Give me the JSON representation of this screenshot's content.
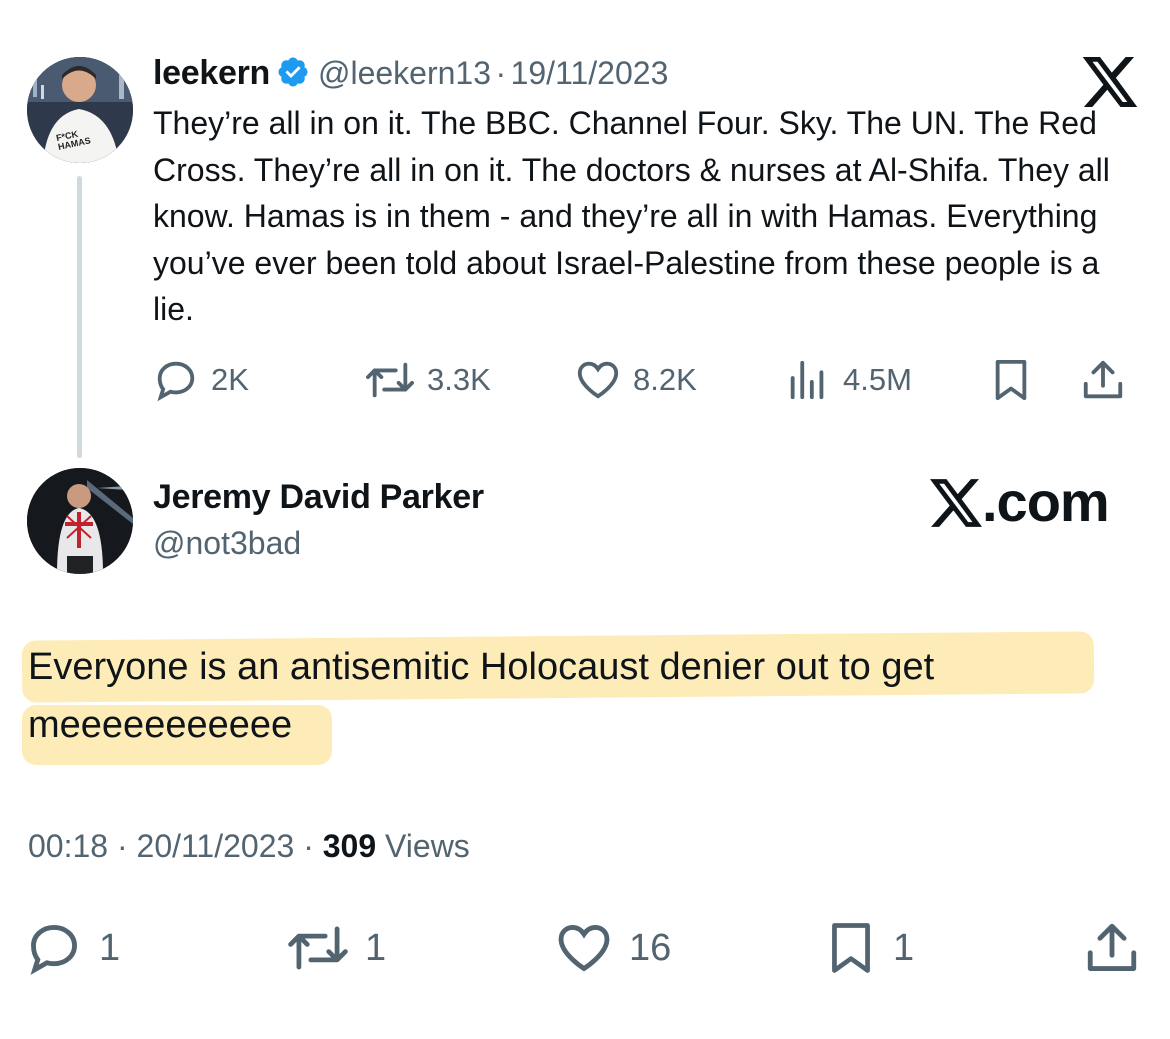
{
  "tweet1": {
    "display_name": "leekern",
    "handle": "@leekern13",
    "separator": "·",
    "date": "19/11/2023",
    "text": "They’re all in on it. The BBC. Channel Four. Sky. The UN. The Red Cross. They’re all in on it. The doctors & nurses at Al-Shifa. They all know. Hamas is in them - and they’re all in with Hamas. Everything you’ve ever been told about Israel-Palestine from these people is a lie.",
    "avatar_shirt_text": "F*CK HAMAS",
    "stats": {
      "replies": "2K",
      "reposts": "3.3K",
      "likes": "8.2K",
      "views": "4.5M"
    }
  },
  "tweet2": {
    "display_name": "Jeremy David Parker",
    "handle": "@not3bad",
    "text": "Everyone is an antisemitic Holocaust denier out to get meeeeeeeeeee",
    "time": "00:18",
    "separator": "·",
    "date": "20/11/2023",
    "views_count": "309",
    "views_label": "Views",
    "stats": {
      "replies": "1",
      "reposts": "1",
      "likes": "16",
      "bookmarks": "1"
    }
  },
  "brand": {
    "watermark_text": ".com",
    "logo_icon": "x-logo-icon"
  },
  "colors": {
    "text": "#0f1419",
    "secondary": "#536471",
    "verified": "#1d9bf0",
    "highlight": "#fdeab0",
    "thread_line": "#cfd9de"
  }
}
